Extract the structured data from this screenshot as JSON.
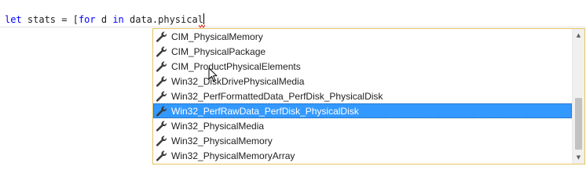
{
  "editor": {
    "code": {
      "let": "let",
      "stats_eq": " stats = [",
      "for": "for",
      "d": " d ",
      "in": "in",
      "expr": " data.physical"
    }
  },
  "completion": {
    "item_icon": "wrench-icon",
    "selected_index": 5,
    "items": [
      "CIM_PhysicalMemory",
      "CIM_PhysicalPackage",
      "CIM_ProductPhysicalElements",
      "Win32_DiskDrivePhysicalMedia",
      "Win32_PerfFormattedData_PerfDisk_PhysicalDisk",
      "Win32_PerfRawData_PerfDisk_PhysicalDisk",
      "Win32_PhysicalMedia",
      "Win32_PhysicalMemory",
      "Win32_PhysicalMemoryArray"
    ],
    "scrollbar": {
      "up_arrow": "▲",
      "down_arrow": "▼"
    }
  },
  "colors": {
    "keyword": "#0000ff",
    "selection": "#3399ff",
    "popup_border": "#e5c365"
  }
}
